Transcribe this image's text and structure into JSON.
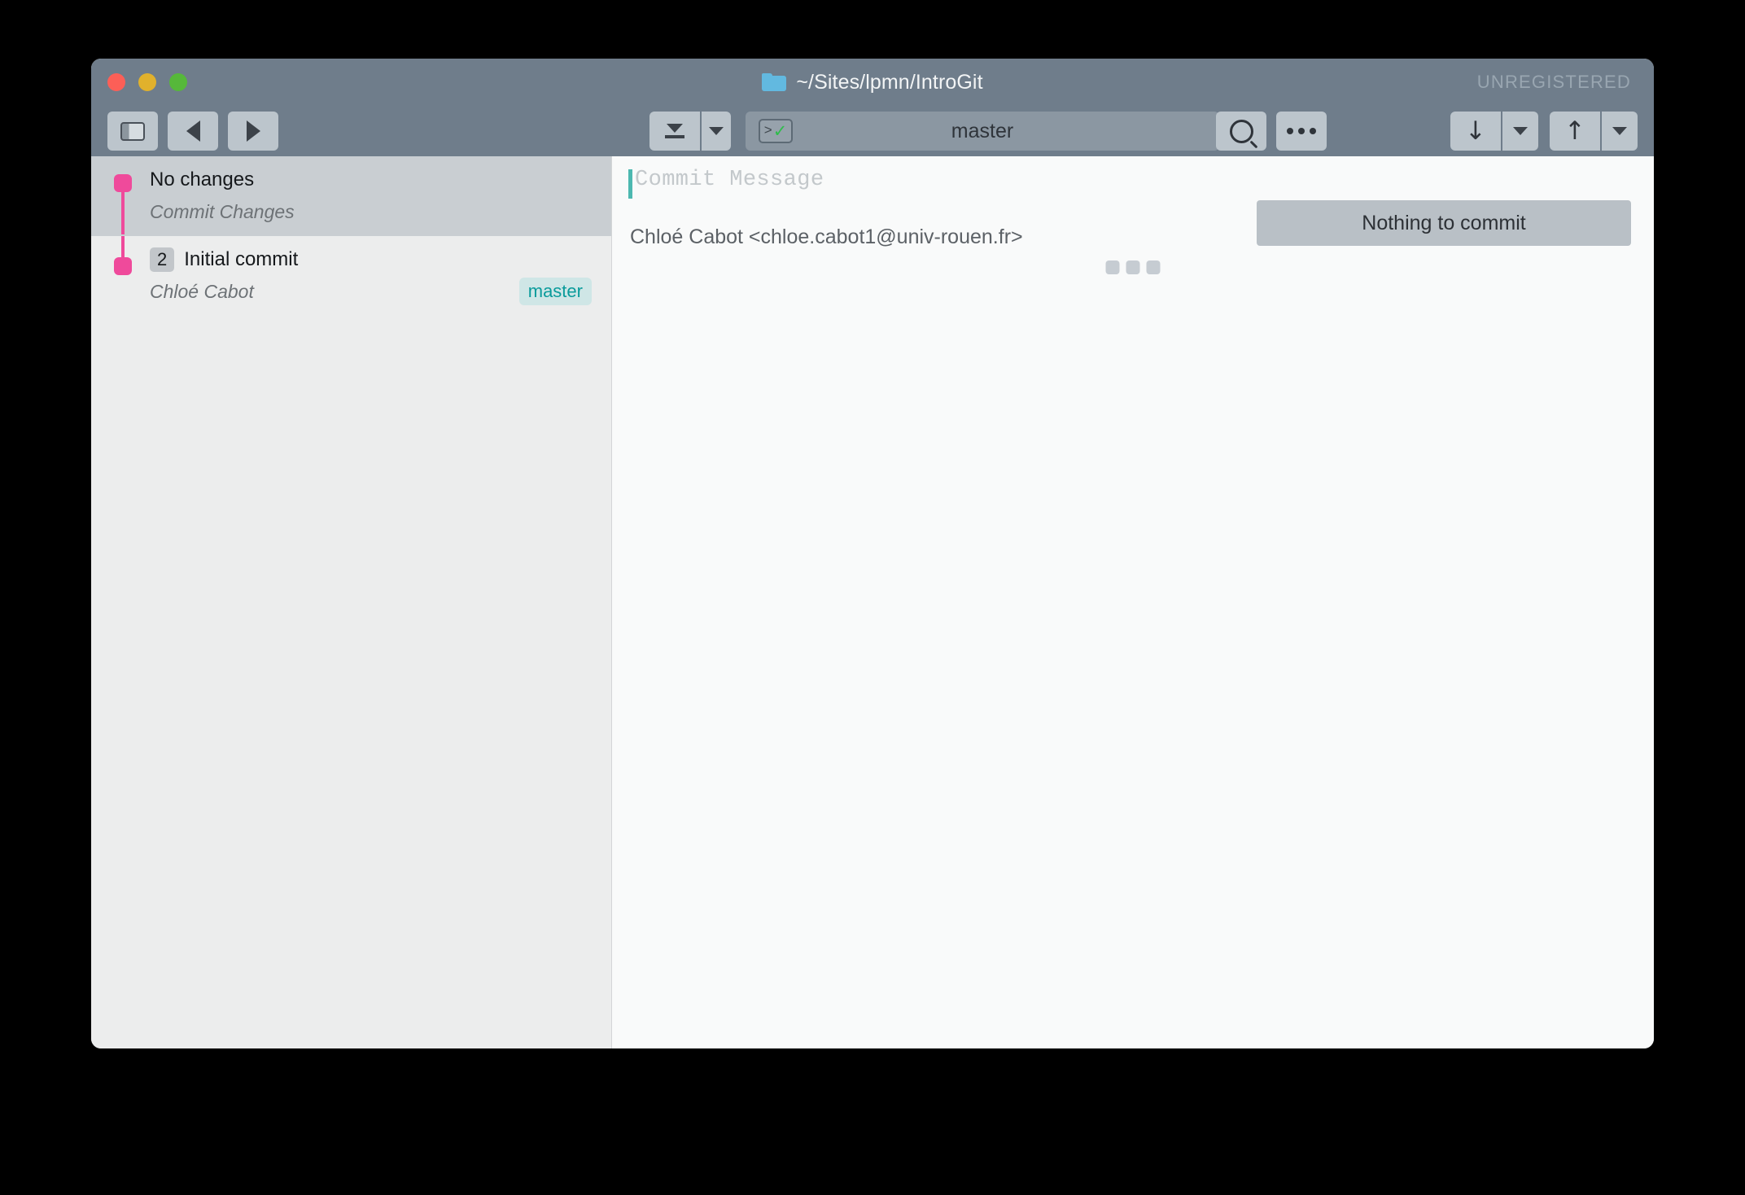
{
  "window": {
    "title": "~/Sites/lpmn/IntroGit",
    "folder_icon": "folder-icon",
    "registration_status": "UNREGISTERED",
    "traffic_lights": [
      {
        "name": "close",
        "color": "#fc5f57"
      },
      {
        "name": "minimize",
        "color": "#e1b12c"
      },
      {
        "name": "maximize",
        "color": "#56b83a"
      }
    ]
  },
  "toolbar": {
    "sidebar_toggle": {
      "icon": "sidebar-toggle-icon",
      "label": ""
    },
    "back": {
      "icon": "triangle-left-icon",
      "label": ""
    },
    "forward": {
      "icon": "triangle-right-icon",
      "label": ""
    },
    "stash": {
      "icon": "stash-icon",
      "label": ""
    },
    "stash_dropdown": {
      "icon": "chevron-down-icon",
      "label": ""
    },
    "terminal": {
      "icon": "terminal-check-icon",
      "label": ""
    },
    "branch_name": "master",
    "search": {
      "icon": "search-icon",
      "label": ""
    },
    "more": {
      "icon": "ellipsis-icon",
      "label": ""
    },
    "pull": {
      "icon": "arrow-down-icon",
      "glyph": "↓",
      "label": ""
    },
    "pull_dropdown": {
      "icon": "chevron-down-icon",
      "label": ""
    },
    "push": {
      "icon": "arrow-up-icon",
      "glyph": "↑",
      "label": ""
    },
    "push_dropdown": {
      "icon": "chevron-down-icon",
      "label": ""
    }
  },
  "sidebar": {
    "commits": [
      {
        "title": "No changes",
        "subtitle": "Commit Changes",
        "count": "",
        "branch_badge": "",
        "selected": true
      },
      {
        "title": "Initial commit",
        "subtitle": "Chloé Cabot",
        "count": "2",
        "branch_badge": "master",
        "selected": false
      }
    ],
    "graph_color": "#ef4a9b"
  },
  "main": {
    "commit_message_placeholder": "Commit Message",
    "commit_message_value": "",
    "author": "Chloé Cabot <chloe.cabot1@univ-rouen.fr>",
    "commit_button_label": "Nothing to commit",
    "drag_handle": "drag-handle-icon"
  },
  "colors": {
    "titlebar": "#6f7d8b",
    "toolbar_button": "#bcc5cc",
    "accent_pink": "#ef4a9b",
    "accent_teal": "#0a9b9b",
    "caret_teal": "#4cb8b0",
    "sidebar_bg": "#eceded",
    "selected_row": "#c9ced2",
    "main_bg": "#f9fafa"
  }
}
